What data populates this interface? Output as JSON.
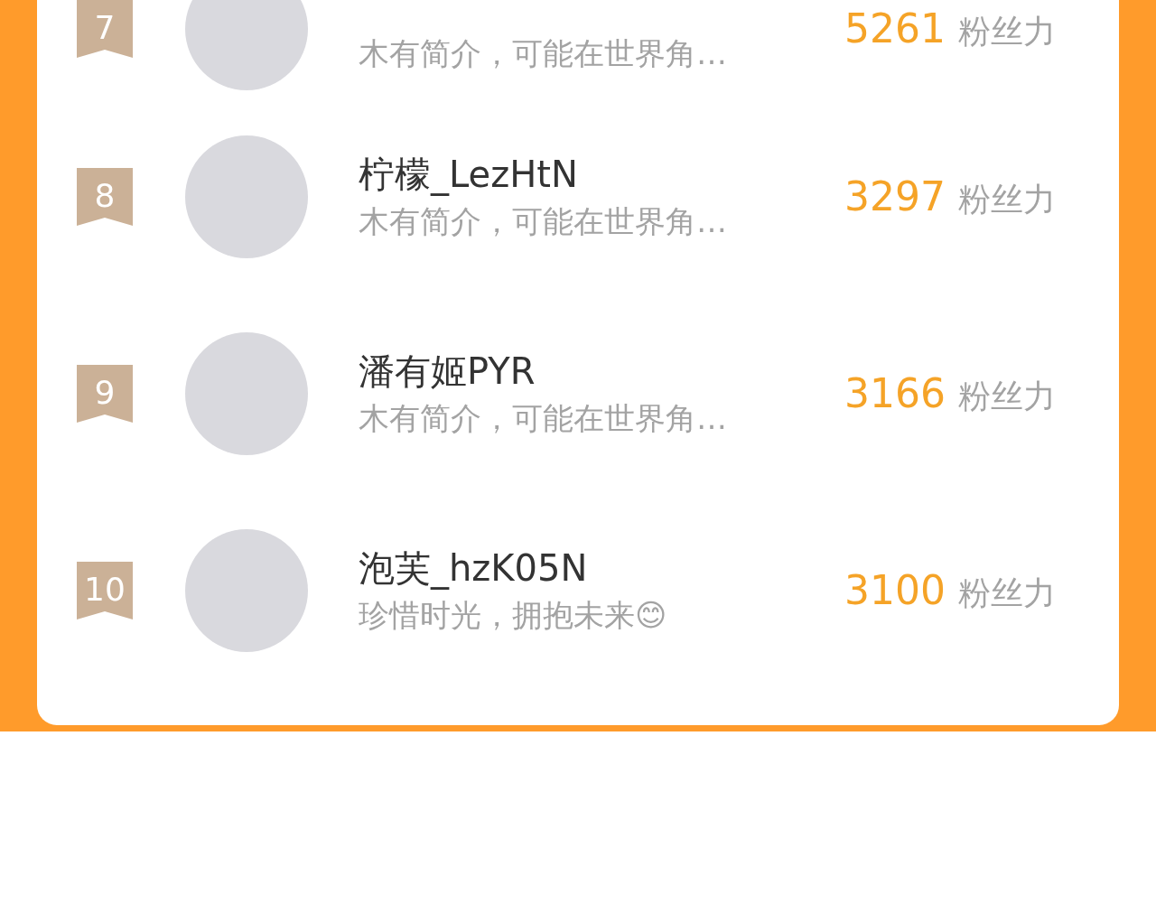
{
  "ranking": [
    {
      "rank": "7",
      "bio": "木有简介，可能在世界角…",
      "score": "5261",
      "score_unit": "粉丝力"
    },
    {
      "rank": "8",
      "name": "柠檬_LezHtN",
      "bio": "木有简介，可能在世界角…",
      "score": "3297",
      "score_unit": "粉丝力"
    },
    {
      "rank": "9",
      "name": "潘有姬PYR",
      "bio": "木有简介，可能在世界角…",
      "score": "3166",
      "score_unit": "粉丝力"
    },
    {
      "rank": "10",
      "name": "泡芙_hzK05N",
      "bio": "珍惜时光，拥抱未来😊",
      "score": "3100",
      "score_unit": "粉丝力"
    }
  ]
}
